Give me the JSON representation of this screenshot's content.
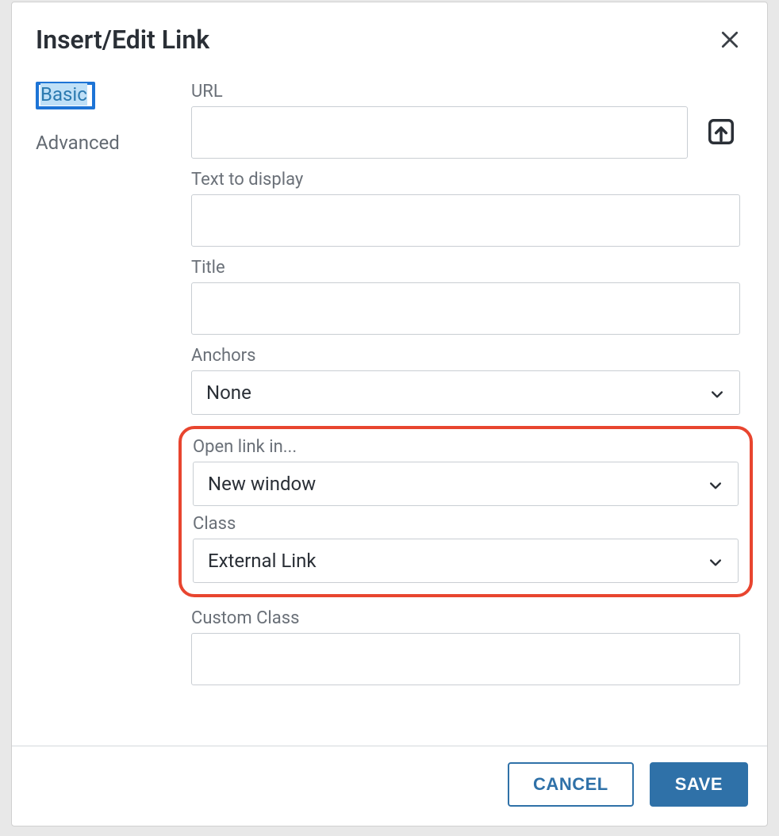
{
  "dialog": {
    "title": "Insert/Edit Link",
    "tabs": {
      "basic": "Basic",
      "advanced": "Advanced"
    },
    "fields": {
      "url_label": "URL",
      "url_value": "",
      "text_display_label": "Text to display",
      "text_display_value": "",
      "title_label": "Title",
      "title_value": "",
      "anchors_label": "Anchors",
      "anchors_value": "None",
      "open_link_label": "Open link in...",
      "open_link_value": "New window",
      "class_label": "Class",
      "class_value": "External Link",
      "custom_class_label": "Custom Class",
      "custom_class_value": ""
    },
    "buttons": {
      "cancel": "CANCEL",
      "save": "SAVE"
    }
  }
}
